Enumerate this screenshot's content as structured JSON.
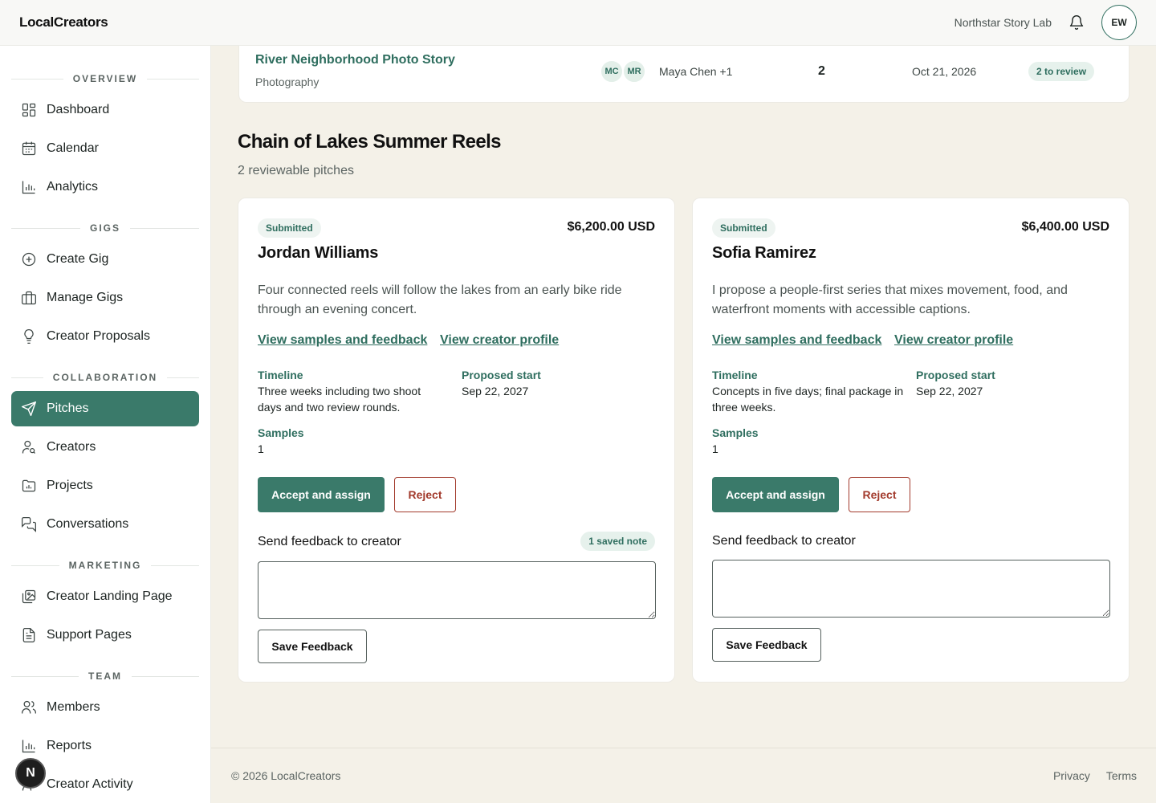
{
  "header": {
    "brand": "LocalCreators",
    "org_name": "Northstar Story Lab",
    "avatar_initials": "EW"
  },
  "sidebar": {
    "sections": [
      "OVERVIEW",
      "GIGS",
      "COLLABORATION",
      "MARKETING",
      "TEAM"
    ],
    "items": [
      {
        "label": "Dashboard",
        "icon": "grid-icon"
      },
      {
        "label": "Calendar",
        "icon": "calendar-icon"
      },
      {
        "label": "Analytics",
        "icon": "bar-chart-icon"
      },
      {
        "label": "Create Gig",
        "icon": "plus-circle-icon"
      },
      {
        "label": "Manage Gigs",
        "icon": "briefcase-icon"
      },
      {
        "label": "Creator Proposals",
        "icon": "lightbulb-icon"
      },
      {
        "label": "Pitches",
        "icon": "send-icon",
        "active": true
      },
      {
        "label": "Creators",
        "icon": "user-search-icon"
      },
      {
        "label": "Projects",
        "icon": "folder-chart-icon"
      },
      {
        "label": "Conversations",
        "icon": "chat-icon"
      },
      {
        "label": "Creator Landing Page",
        "icon": "image-gallery-icon"
      },
      {
        "label": "Support Pages",
        "icon": "document-icon"
      },
      {
        "label": "Members",
        "icon": "users-icon"
      },
      {
        "label": "Reports",
        "icon": "bar-chart-icon"
      },
      {
        "label": "Creator Activity",
        "icon": "activity-icon"
      }
    ],
    "floating_badge": "N"
  },
  "project_row": {
    "title": "River Neighborhood Photo Story",
    "category": "Photography",
    "avatars": [
      "MC",
      "MR"
    ],
    "members": "Maya Chen +1",
    "count": "2",
    "date": "Oct 21, 2026",
    "review_pill": "2 to review"
  },
  "gig": {
    "title": "Chain of Lakes Summer Reels",
    "subtitle": "2 reviewable pitches"
  },
  "pitches": [
    {
      "status": "Submitted",
      "amount": "$6,200.00 USD",
      "creator": "Jordan Williams",
      "description": "Four connected reels will follow the lakes from an early bike ride through an evening concert.",
      "link_samples": "View samples and feedback",
      "link_profile": "View creator profile",
      "timeline_label": "Timeline",
      "timeline": "Three weeks including two shoot days and two review rounds.",
      "start_label": "Proposed start",
      "start": "Sep 22, 2027",
      "samples_label": "Samples",
      "samples": "1",
      "accept_label": "Accept and assign",
      "reject_label": "Reject",
      "feedback_label": "Send feedback to creator",
      "saved_note": "1 saved note",
      "feedback_value": "",
      "save_label": "Save Feedback"
    },
    {
      "status": "Submitted",
      "amount": "$6,400.00 USD",
      "creator": "Sofia Ramirez",
      "description": "I propose a people-first series that mixes movement, food, and waterfront moments with accessible captions.",
      "link_samples": "View samples and feedback",
      "link_profile": "View creator profile",
      "timeline_label": "Timeline",
      "timeline": "Concepts in five days; final package in three weeks.",
      "start_label": "Proposed start",
      "start": "Sep 22, 2027",
      "samples_label": "Samples",
      "samples": "1",
      "accept_label": "Accept and assign",
      "reject_label": "Reject",
      "feedback_label": "Send feedback to creator",
      "feedback_value": "",
      "save_label": "Save Feedback"
    }
  ],
  "footer": {
    "copyright": "© 2026 LocalCreators",
    "privacy": "Privacy",
    "terms": "Terms"
  },
  "colors": {
    "accent": "#3a7a6a",
    "accent_text": "#2f6e5f",
    "danger": "#a23a2c",
    "page_bg": "#f4f1e8"
  }
}
